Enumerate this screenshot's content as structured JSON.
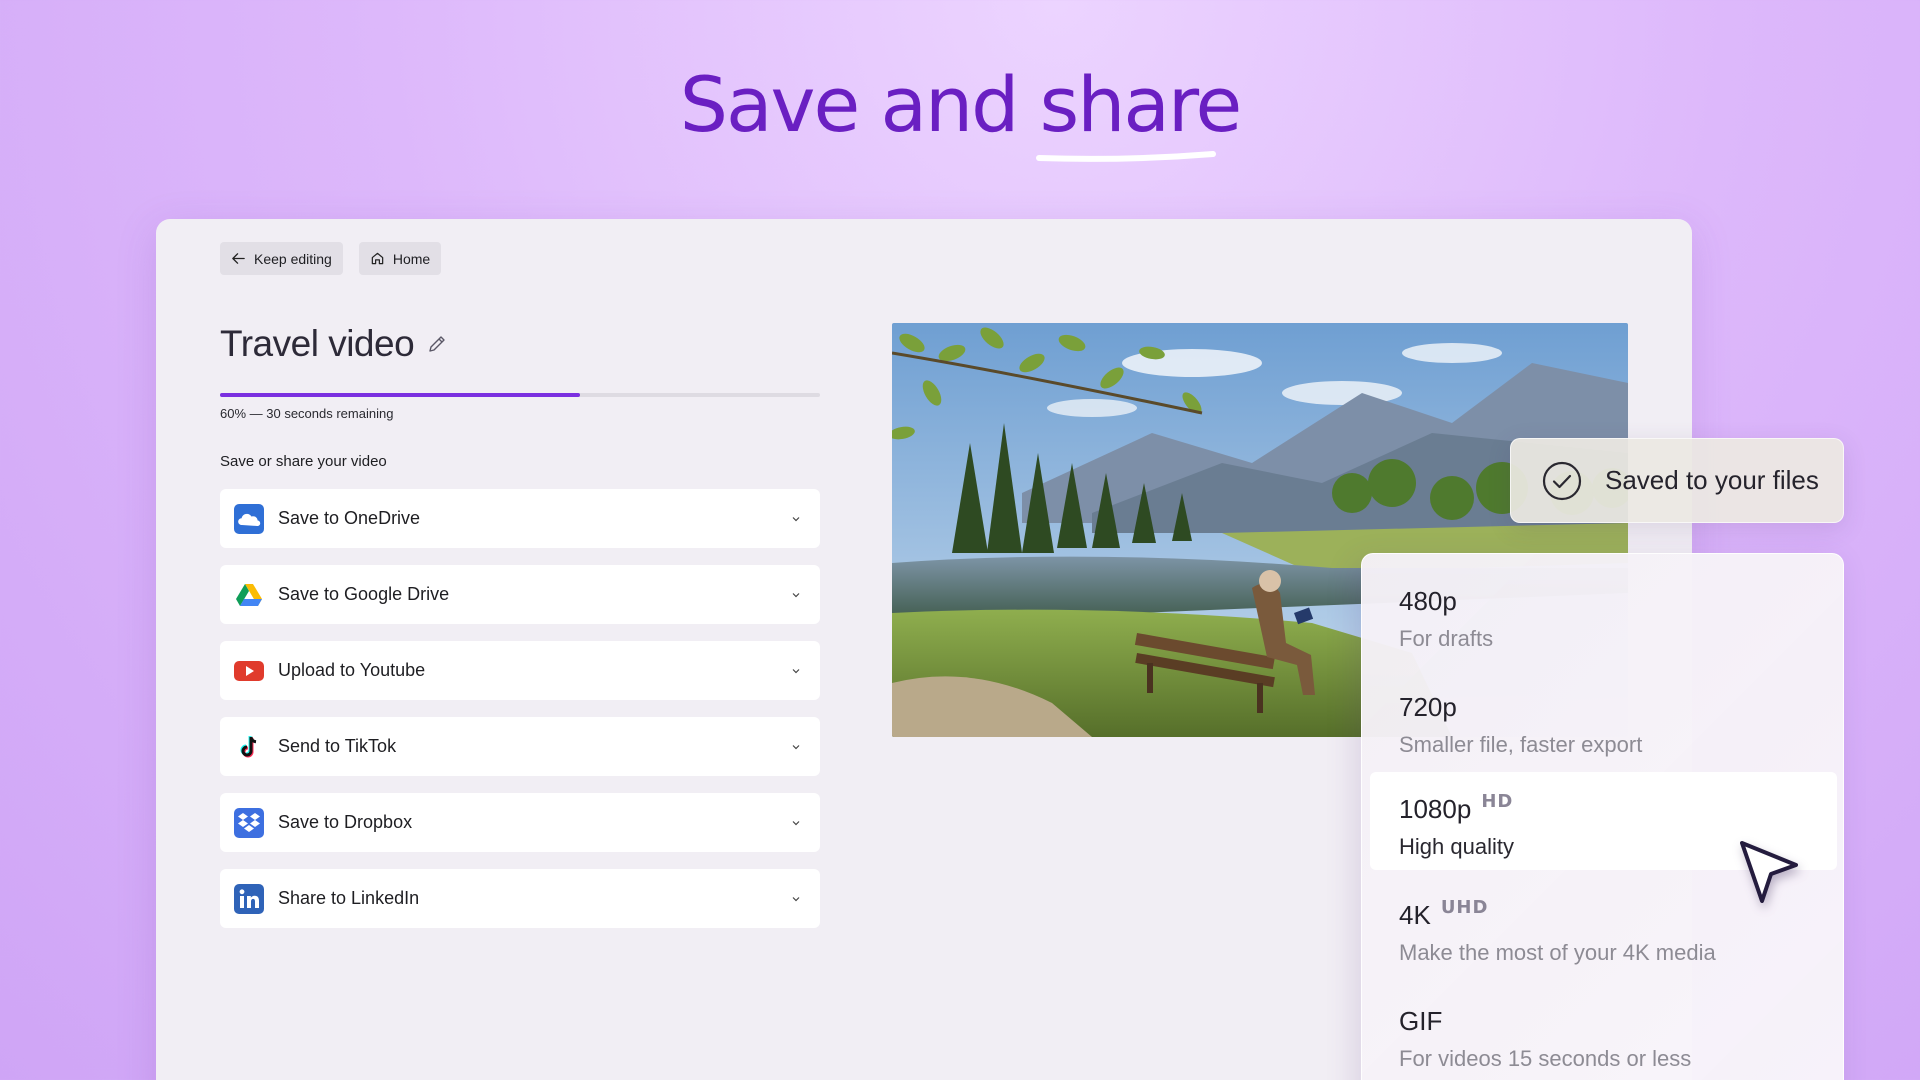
{
  "headline": {
    "part1": "Save and ",
    "accent": "share"
  },
  "nav": {
    "keep_editing": "Keep editing",
    "home": "Home"
  },
  "project": {
    "title": "Travel video",
    "progress_percent": 60,
    "progress_text": "60% — 30 seconds remaining"
  },
  "share_section": {
    "label": "Save or share your video",
    "options": [
      {
        "label": "Save to OneDrive",
        "icon": "onedrive-icon"
      },
      {
        "label": "Save to Google Drive",
        "icon": "google-drive-icon"
      },
      {
        "label": "Upload to Youtube",
        "icon": "youtube-icon"
      },
      {
        "label": "Send to TikTok",
        "icon": "tiktok-icon"
      },
      {
        "label": "Save to Dropbox",
        "icon": "dropbox-icon"
      },
      {
        "label": "Share to LinkedIn",
        "icon": "linkedin-icon"
      }
    ]
  },
  "toast": {
    "text": "Saved to your files",
    "icon": "check-circle-icon"
  },
  "quality_menu": {
    "selected_index": 2,
    "items": [
      {
        "title": "480p",
        "badge": "",
        "desc": "For drafts"
      },
      {
        "title": "720p",
        "badge": "",
        "desc": "Smaller file, faster export"
      },
      {
        "title": "1080p",
        "badge": "HD",
        "desc": "High quality"
      },
      {
        "title": "4K",
        "badge": "UHD",
        "desc": "Make the most of your 4K media"
      },
      {
        "title": "GIF",
        "badge": "",
        "desc": "For videos 15 seconds or less"
      }
    ]
  },
  "colors": {
    "accent_purple": "#7b2fe0",
    "headline_purple": "#6a1fc2",
    "background": "#ddb8fb"
  }
}
